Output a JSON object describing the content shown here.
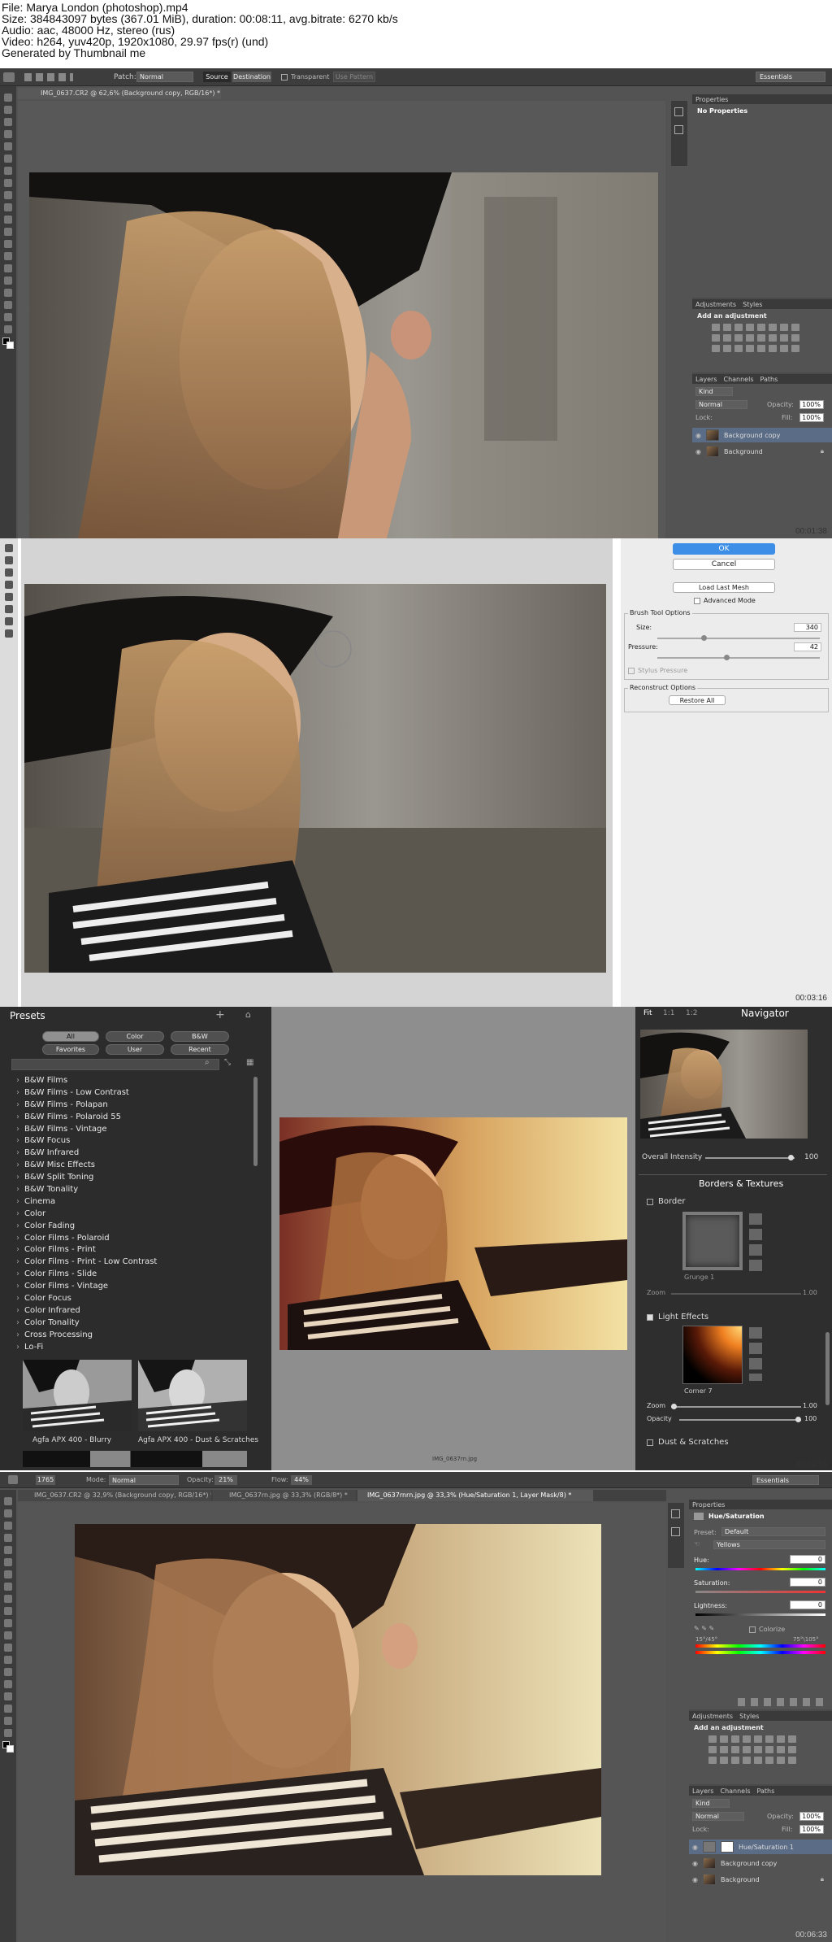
{
  "info": {
    "line1": "File: Marya London (photoshop).mp4",
    "line2": "Size: 384843097 bytes (367.01 MiB), duration: 00:08:11, avg.bitrate: 6270 kb/s",
    "line3": "Audio: aac, 48000 Hz, stereo (rus)",
    "line4": "Video: h264, yuv420p, 1920x1080, 29.97 fps(r) (und)",
    "line5": "Generated by Thumbnail me"
  },
  "timestamps": [
    "00:01:38",
    "00:03:16",
    "00:04:55",
    "00:06:33"
  ],
  "frame1": {
    "options": {
      "patch_label": "Patch:",
      "patch_value": "Normal",
      "source": "Source",
      "destination": "Destination",
      "transparent": "Transparent",
      "use_pattern": "Use Pattern",
      "workspace": "Essentials"
    },
    "doc_tab": "IMG_0637.CR2 @ 62,6% (Background copy, RGB/16*) *",
    "properties": {
      "tab": "Properties",
      "empty": "No Properties"
    },
    "adjustments": {
      "tab1": "Adjustments",
      "tab2": "Styles",
      "add": "Add an adjustment"
    },
    "layers": {
      "tabs": [
        "Layers",
        "Channels",
        "Paths"
      ],
      "kind": "Kind",
      "blend": "Normal",
      "opacity_label": "Opacity:",
      "opacity": "100%",
      "lock_label": "Lock:",
      "fill_label": "Fill:",
      "fill": "100%",
      "rows": [
        "Background copy",
        "Background"
      ]
    }
  },
  "frame2": {
    "ok": "OK",
    "cancel": "Cancel",
    "load_mesh": "Load Last Mesh",
    "advanced": "Advanced Mode",
    "brush_group": "Brush Tool Options",
    "size_label": "Size:",
    "size": "340",
    "pressure_label": "Pressure:",
    "pressure": "42",
    "stylus": "Stylus Pressure",
    "reconstruct_group": "Reconstruct Options",
    "restore": "Restore All"
  },
  "frame3": {
    "presets_title": "Presets",
    "filters": [
      "All",
      "Color",
      "B&W",
      "Favorites",
      "User",
      "Recent"
    ],
    "list": [
      "B&W Films",
      "B&W Films - Low Contrast",
      "B&W Films - Polapan",
      "B&W Films - Polaroid 55",
      "B&W Films - Vintage",
      "B&W Focus",
      "B&W Infrared",
      "B&W Misc Effects",
      "B&W Split Toning",
      "B&W Tonality",
      "Cinema",
      "Color",
      "Color Fading",
      "Color Films - Polaroid",
      "Color Films - Print",
      "Color Films - Print - Low Contrast",
      "Color Films - Slide",
      "Color Films - Vintage",
      "Color Focus",
      "Color Infrared",
      "Color Tonality",
      "Cross Processing",
      "Lo-Fi"
    ],
    "thumb1": "Agfa APX 400 - Blurry",
    "thumb2": "Agfa APX 400 - Dust & Scratches",
    "filename": "IMG_0637rn.jpg",
    "nav": {
      "fit": "Fit",
      "z1": "1:1",
      "z2": "1:2",
      "title": "Navigator"
    },
    "intensity_label": "Overall Intensity",
    "intensity": "100",
    "borders_title": "Borders & Textures",
    "border": "Border",
    "border_preset": "Grunge 1",
    "zoom_label": "Zoom",
    "zoom1": "1.00",
    "light": "Light Effects",
    "light_preset": "Corner 7",
    "zoom2": "1.00",
    "opacity_label": "Opacity",
    "opacity": "100",
    "dust": "Dust & Scratches"
  },
  "frame4": {
    "options": {
      "mode_label": "Mode:",
      "mode": "Normal",
      "opacity_label": "Opacity:",
      "opacity": "21%",
      "flow_label": "Flow:",
      "flow": "44%",
      "size": "1765",
      "workspace": "Essentials"
    },
    "tabs": [
      "IMG_0637.CR2 @ 32,9% (Background copy, RGB/16*) *",
      "IMG_0637rn.jpg @ 33,3% (RGB/8*) *",
      "IMG_0637rnrn.jpg @ 33,3% (Hue/Saturation 1, Layer Mask/8) *"
    ],
    "properties": {
      "tab": "Properties",
      "title": "Hue/Saturation",
      "preset_label": "Preset:",
      "preset": "Default",
      "channel": "Yellows",
      "hue_label": "Hue:",
      "hue": "0",
      "sat_label": "Saturation:",
      "sat": "0",
      "light_label": "Lightness:",
      "light": "0",
      "colorize": "Colorize",
      "range_left": "15°/45°",
      "range_right": "75°\\105°"
    },
    "adjustments": {
      "tab1": "Adjustments",
      "tab2": "Styles",
      "add": "Add an adjustment"
    },
    "layers": {
      "tabs": [
        "Layers",
        "Channels",
        "Paths"
      ],
      "kind": "Kind",
      "blend": "Normal",
      "opacity_label": "Opacity:",
      "opacity": "100%",
      "lock_label": "Lock:",
      "fill_label": "Fill:",
      "fill": "100%",
      "rows": [
        "Hue/Saturation 1",
        "Background copy",
        "Background"
      ]
    }
  }
}
